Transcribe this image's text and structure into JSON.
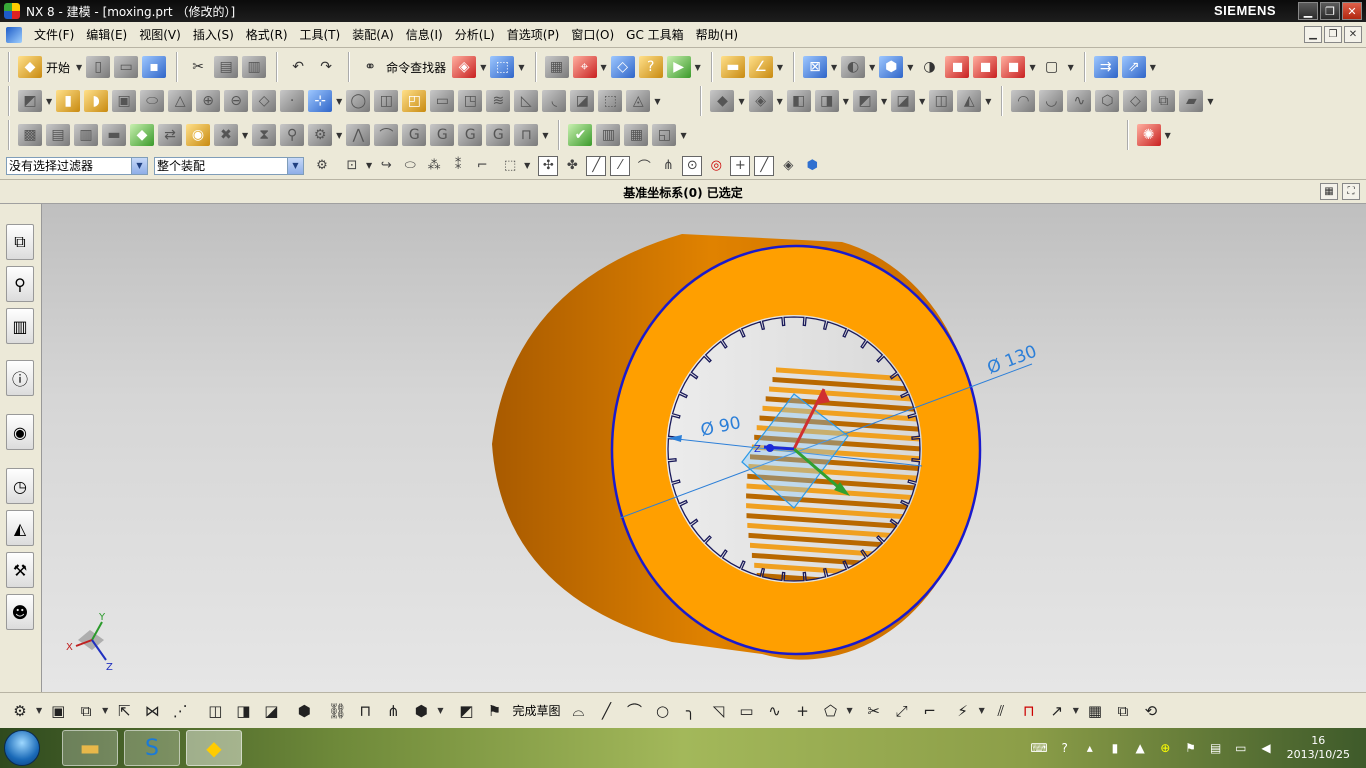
{
  "window": {
    "title": "NX 8 - 建模 - [moxing.prt （修改的）]",
    "brand": "SIEMENS"
  },
  "menu": [
    "文件(F)",
    "编辑(E)",
    "视图(V)",
    "插入(S)",
    "格式(R)",
    "工具(T)",
    "装配(A)",
    "信息(I)",
    "分析(L)",
    "首选项(P)",
    "窗口(O)",
    "GC 工具箱",
    "帮助(H)"
  ],
  "toolbar": {
    "start_label": "开始",
    "command_finder_label": "命令查找器"
  },
  "selection": {
    "filter_value": "没有选择过滤器",
    "scope_value": "整个装配"
  },
  "status": {
    "message": "基准坐标系(0) 已选定"
  },
  "model": {
    "dim_outer": "Ø 130",
    "dim_inner": "Ø 90",
    "part_color": "#ff9f00",
    "edge_color": "#1a1acc",
    "triad_labels": {
      "x": "X",
      "y": "Y",
      "z": "Z"
    }
  },
  "sketch": {
    "finish_label": "完成草图"
  },
  "taskbar": {
    "date": "2013/10/25",
    "time": "16"
  }
}
